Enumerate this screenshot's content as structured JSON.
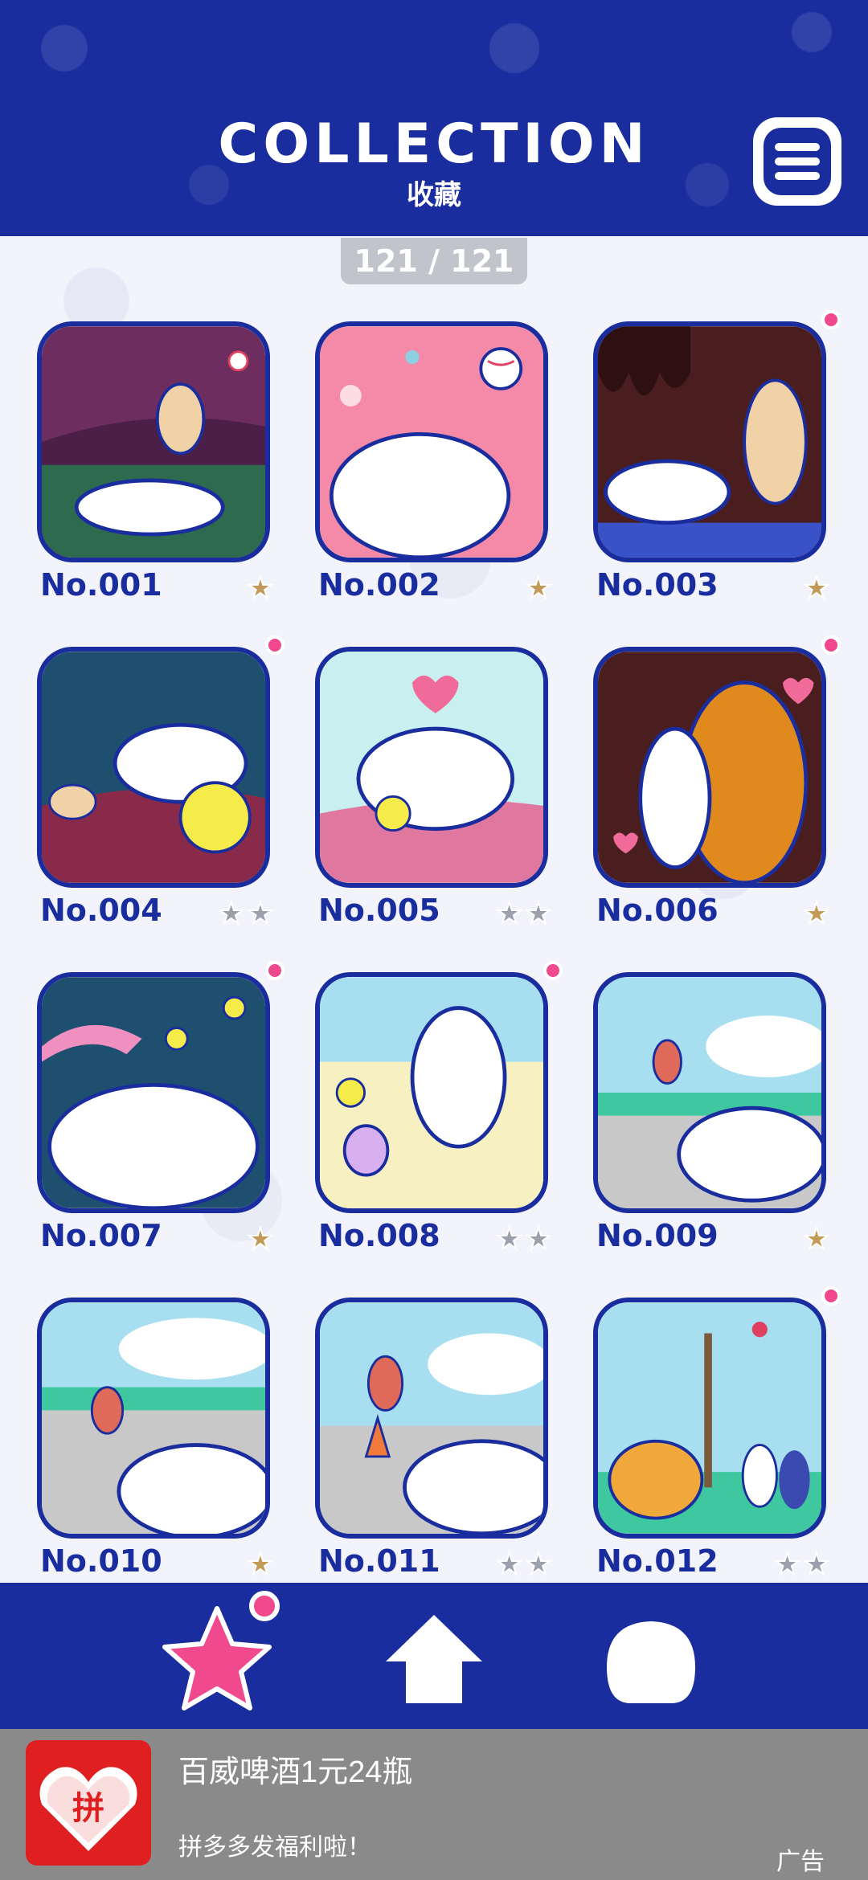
{
  "header": {
    "title": "COLLECTION",
    "subtitle": "收藏",
    "menu_icon": "menu-icon"
  },
  "counter": "121 / 121",
  "colors": {
    "primary": "#1a2d9e",
    "accent_pink": "#f0498d",
    "star_gold": "#c39a58",
    "star_grey": "#9ca0ad",
    "ad_gray": "#8a8a8a"
  },
  "cards": [
    {
      "label": "No.001",
      "stars": [
        "gold"
      ],
      "new": false
    },
    {
      "label": "No.002",
      "stars": [
        "gold"
      ],
      "new": false
    },
    {
      "label": "No.003",
      "stars": [
        "gold"
      ],
      "new": true
    },
    {
      "label": "No.004",
      "stars": [
        "grey",
        "grey"
      ],
      "new": true
    },
    {
      "label": "No.005",
      "stars": [
        "grey",
        "grey"
      ],
      "new": false
    },
    {
      "label": "No.006",
      "stars": [
        "gold"
      ],
      "new": true
    },
    {
      "label": "No.007",
      "stars": [
        "gold"
      ],
      "new": true
    },
    {
      "label": "No.008",
      "stars": [
        "grey",
        "grey"
      ],
      "new": true
    },
    {
      "label": "No.009",
      "stars": [
        "gold"
      ],
      "new": false
    },
    {
      "label": "No.010",
      "stars": [
        "gold"
      ],
      "new": false
    },
    {
      "label": "No.011",
      "stars": [
        "grey",
        "grey"
      ],
      "new": false
    },
    {
      "label": "No.012",
      "stars": [
        "grey",
        "grey"
      ],
      "new": true
    }
  ],
  "bottom_nav": [
    {
      "icon": "star-icon",
      "active": true,
      "badge": true
    },
    {
      "icon": "home-icon",
      "active": false,
      "badge": false
    },
    {
      "icon": "dog-head-icon",
      "active": false,
      "badge": false
    }
  ],
  "ad": {
    "title": "百威啤酒1元24瓶",
    "description": "拼多多发福利啦！",
    "tag": "广告",
    "logo_text": "拼"
  }
}
